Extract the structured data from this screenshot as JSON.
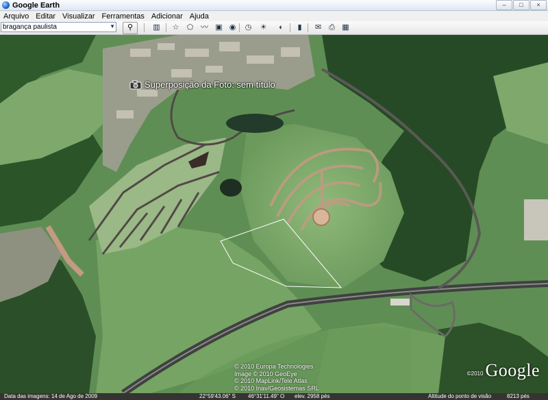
{
  "window": {
    "title": "Google Earth",
    "minimize": "–",
    "maximize": "□",
    "close": "×"
  },
  "menu": [
    "Arquivo",
    "Editar",
    "Visualizar",
    "Ferramentas",
    "Adicionar",
    "Ajuda"
  ],
  "search": {
    "value": "bragança paulista"
  },
  "toolbar": {
    "icons": [
      "sidebar-icon",
      "placemark-icon",
      "polygon-icon",
      "path-icon",
      "image-overlay-icon",
      "record-tour-icon",
      "historical-imagery-icon",
      "sunlight-icon",
      "planets-icon",
      "ruler-icon",
      "email-icon",
      "print-icon",
      "view-in-maps-icon"
    ]
  },
  "map": {
    "overlay_label": "Superposição da Foto: sem título",
    "copyright_lines": [
      "© 2010 Europa Technologies",
      "Image © 2010 GeoEye",
      "© 2010 MapLink/Tele Atlas",
      "© 2010 Inav/Geosistemas SRL"
    ],
    "watermark_year": "©2010",
    "logo": "Google"
  },
  "status": {
    "imagery_date": "Data das imagens: 14 de Ago de 2009",
    "latitude": "22°59'43.06\" S",
    "longitude": "46°31'11.49\" O",
    "elevation": "elev.  2958 pés",
    "eye_altitude_label": "Altitude do ponto de visão",
    "eye_altitude_value": "8213 pés"
  },
  "colors": {
    "overlay_outline": "#ffffff",
    "status_bg": "#000000"
  }
}
